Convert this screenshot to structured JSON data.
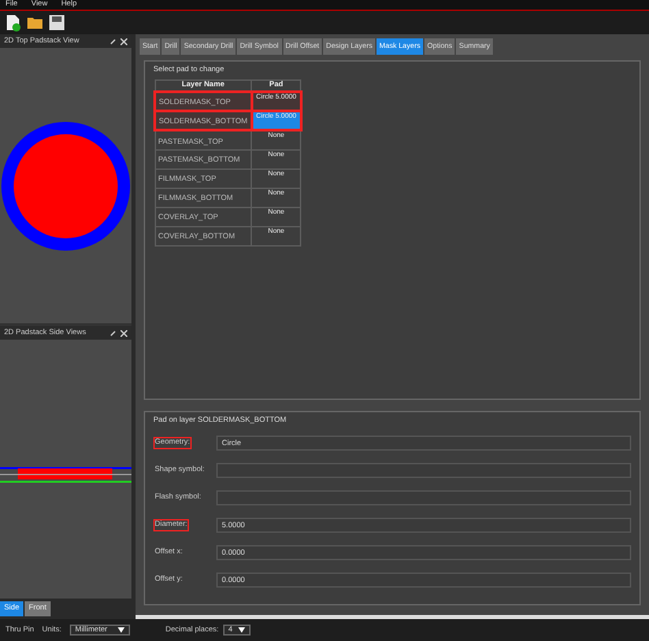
{
  "menu": [
    "File",
    "View",
    "Help"
  ],
  "left_panels": [
    {
      "title": "2D Top Padstack View",
      "kind": "top"
    },
    {
      "title": "2D Padstack Side Views",
      "kind": "side"
    }
  ],
  "side_tabs": [
    {
      "label": "Side",
      "selected": true
    },
    {
      "label": "Front",
      "selected": false
    }
  ],
  "tabs": [
    {
      "label": "Start",
      "selected": false
    },
    {
      "label": "Drill",
      "selected": false
    },
    {
      "label": "Secondary Drill",
      "selected": false
    },
    {
      "label": "Drill Symbol",
      "selected": false
    },
    {
      "label": "Drill Offset",
      "selected": false
    },
    {
      "label": "Design Layers",
      "selected": false
    },
    {
      "label": "Mask Layers",
      "selected": true
    },
    {
      "label": "Options",
      "selected": false
    },
    {
      "label": "Summary",
      "selected": false
    }
  ],
  "pad_table": {
    "title": "Select pad to change",
    "columns": [
      "Layer Name",
      "Pad"
    ],
    "rows": [
      {
        "layer": "SOLDERMASK_TOP",
        "pad": "Circle 5.0000",
        "selected": false,
        "highlighted": true
      },
      {
        "layer": "SOLDERMASK_BOTTOM",
        "pad": "Circle 5.0000",
        "selected": true,
        "highlighted": true
      },
      {
        "layer": "PASTEMASK_TOP",
        "pad": "None",
        "selected": false,
        "highlighted": false
      },
      {
        "layer": "PASTEMASK_BOTTOM",
        "pad": "None",
        "selected": false,
        "highlighted": false
      },
      {
        "layer": "FILMMASK_TOP",
        "pad": "None",
        "selected": false,
        "highlighted": false
      },
      {
        "layer": "FILMMASK_BOTTOM",
        "pad": "None",
        "selected": false,
        "highlighted": false
      },
      {
        "layer": "COVERLAY_TOP",
        "pad": "None",
        "selected": false,
        "highlighted": false
      },
      {
        "layer": "COVERLAY_BOTTOM",
        "pad": "None",
        "selected": false,
        "highlighted": false
      }
    ]
  },
  "pad_group": {
    "title": "Pad on layer SOLDERMASK_BOTTOM",
    "fields": [
      {
        "label": "Geometry:",
        "value": "Circle",
        "highlighted": true
      },
      {
        "label": "Shape symbol:",
        "highlighted": false
      },
      {
        "label": "Flash symbol:",
        "highlighted": false
      },
      {
        "label": "Diameter:",
        "value": "5.0000",
        "highlighted": true
      },
      {
        "label": "Offset x:",
        "value": "0.0000",
        "highlighted": false
      },
      {
        "label": "Offset y:",
        "value": "0.0000",
        "highlighted": false
      }
    ]
  },
  "status_bar": {
    "type": "Thru Pin",
    "units_label": "Units:",
    "units": "Millimeter",
    "decimal_label": "Decimal places:",
    "decimal": "4"
  }
}
